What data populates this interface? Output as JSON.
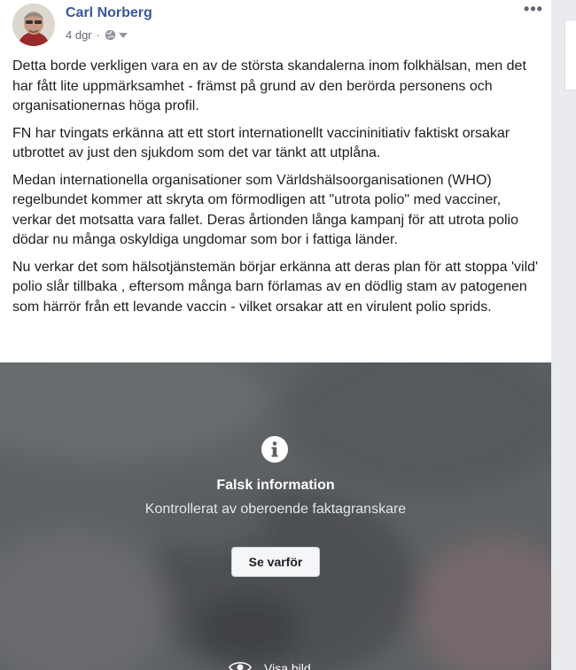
{
  "post": {
    "author": "Carl Norberg",
    "time": "4 dgr",
    "separator": "·",
    "paragraphs": [
      "Detta borde verkligen vara en av de största skandalerna inom folkhälsan, men det har fått lite uppmärksamhet - främst på grund av den berörda personens och organisationernas höga profil.",
      "FN har tvingats erkänna att ett stort internationellt vaccininitiativ faktiskt orsakar utbrottet av just den sjukdom som det var tänkt att utplåna.",
      "Medan internationella organisationer som Världshälsoorganisationen (WHO) regelbundet kommer att skryta om förmodligen att \"utrota polio\" med vacciner, verkar det motsatta vara fallet. Deras årtionden långa kampanj för att utrota polio dödar nu många oskyldiga ungdomar som bor i fattiga länder.",
      "Nu verkar det som hälsotjänstemän börjar erkänna att deras plan för att stoppa 'vild' polio slår tillbaka , eftersom många barn förlamas av en dödlig stam av patogenen som härrör från ett levande vaccin - vilket orsakar att en virulent polio sprids."
    ],
    "more_label": "•••"
  },
  "fact_check": {
    "icon": "info-icon",
    "title": "Falsk information",
    "subtitle": "Kontrollerat av oberoende faktagranskare",
    "button_label": "Se varför",
    "see_photo_label": "Visa bild"
  },
  "colors": {
    "author_link": "#385898",
    "overlay": "#5f6264",
    "text": "#1c1e21"
  }
}
